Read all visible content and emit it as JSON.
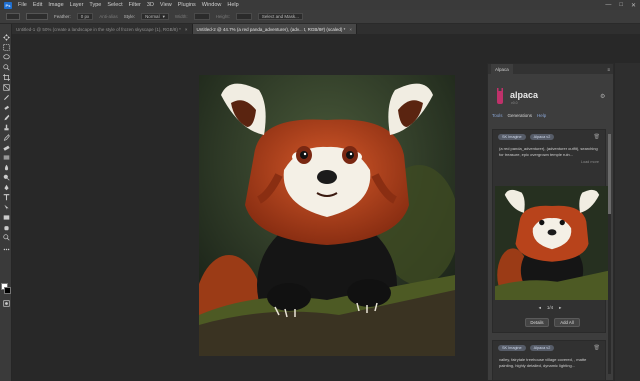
{
  "menubar": {
    "logo": "Ps",
    "items": [
      "File",
      "Edit",
      "Image",
      "Layer",
      "Type",
      "Select",
      "Filter",
      "3D",
      "View",
      "Plugins",
      "Window",
      "Help"
    ],
    "controls": [
      "—",
      "□",
      "✕"
    ]
  },
  "options": {
    "feather_label": "Feather:",
    "feather_value": "0 px",
    "antialias_label": "Anti-alias",
    "style_label": "Style:",
    "style_value": "Normal",
    "width_label": "Width:",
    "height_label": "Height:",
    "select_mask": "Select and Mask..."
  },
  "tabs": [
    {
      "label": "Untitled-1 @ 50% (create a landscape in the style of frozen skyscape (1), RGB/8) *"
    },
    {
      "label": "Untitled-2 @ 44.7% (a red panda_adventurer), (adv... t, RGB/8#) (scaled) *"
    }
  ],
  "panel": {
    "title": "Alpaca",
    "name": "alpaca",
    "version": "v0.0",
    "tabs": [
      "Tools",
      "Generations",
      "Help"
    ],
    "cards": [
      {
        "chips": [
          "SK Imagine",
          "Alpaca v2"
        ],
        "prompt": "(a red panda_adventurer), (adventurer outfit), searching for treasure, epic overgrown temple ruin...",
        "load_more": "Load more",
        "pager": {
          "prev": "◂",
          "label": "1/4",
          "next": "▸"
        },
        "buttons": [
          "Details",
          "Add All"
        ]
      },
      {
        "chips": [
          "SK Imagine",
          "Alpaca v2"
        ],
        "prompt": "valley, fairytale treehouse village covered, , matte painting, highly detailed, dynamic lighting..."
      }
    ]
  },
  "colors": {
    "accent": "#8aa6d6",
    "plugin_icon": "#c0316a",
    "fox": "#b8431b",
    "moss": "#4d5a24"
  }
}
